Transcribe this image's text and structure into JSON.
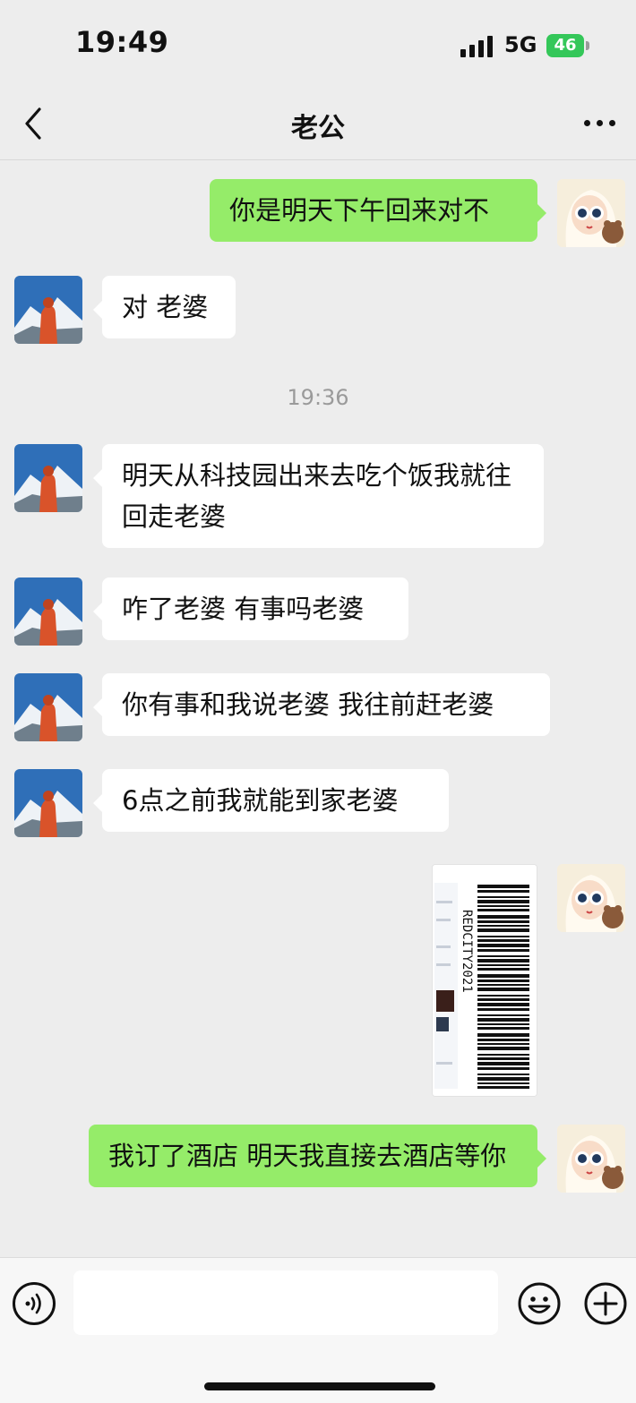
{
  "status_bar": {
    "time": "19:49",
    "network": "5G",
    "battery": "46"
  },
  "nav": {
    "title": "老公",
    "back_icon": "chevron-left-icon",
    "more_icon": "more-dots-icon"
  },
  "messages": [
    {
      "side": "right",
      "text": "你是明天下午回来对不"
    },
    {
      "side": "left",
      "text": "对 老婆"
    },
    {
      "side": "left",
      "text": "明天从科技园出来去吃个饭我就往回走老婆"
    },
    {
      "side": "left",
      "text": "咋了老婆 有事吗老婆"
    },
    {
      "side": "left",
      "text": "你有事和我说老婆 我往前赶老婆"
    },
    {
      "side": "left",
      "text": "6点之前我就能到家老婆"
    },
    {
      "side": "right",
      "type": "image",
      "image_text": "REDCITY2021"
    },
    {
      "side": "right",
      "text": "我订了酒店 明天我直接去酒店等你"
    }
  ],
  "timestamp": "19:36",
  "input_bar": {
    "voice_icon": "voice-icon",
    "input_placeholder": "",
    "emoji_icon": "emoji-icon",
    "plus_icon": "plus-circle-icon"
  },
  "colors": {
    "background": "#ededed",
    "sent_bubble": "#95ec69",
    "received_bubble": "#ffffff",
    "battery": "#34c759"
  }
}
